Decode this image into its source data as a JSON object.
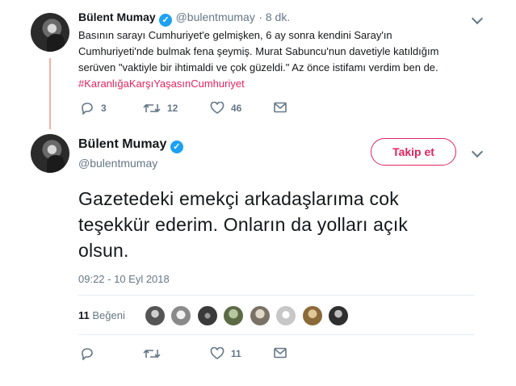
{
  "reply_tweet": {
    "name": "Bülent Mumay",
    "handle": "@bulentmumay",
    "time": "· 8 dk.",
    "text_lines": [
      "Basının sarayı Cumhuriyet'e gelmişken, 6 ay sonra kendini Saray'ın",
      "Cumhuriyeti'nde bulmak fena şeymiş. Murat Sabuncu'nun davetiyle katıldığım",
      "serüven \"vaktiyle bir ihtimaldi ve çok güzeldi.\" Az önce istifamı verdim ben de."
    ],
    "hashtag": "#KaranlığaKarşıYaşasınCumhuriyet",
    "replies": "3",
    "retweets": "12",
    "likes": "46"
  },
  "main_tweet": {
    "name": "Bülent Mumay",
    "handle": "@bulentmumay",
    "follow_label": "Takip et",
    "text": "Gazetedeki emekçi arkadaşlarıma cok teşekkür ederim. Onların da yolları açık olsun.",
    "timestamp": "09:22 - 10 Eyl 2018",
    "likes_count": "11",
    "likes_label": "Beğeni",
    "action_likes": "11"
  },
  "colors": {
    "accent": "#e0245e",
    "verified": "#1da1f2",
    "thread_line": "#f5b0a3",
    "muted": "#657786"
  },
  "icons": [
    "verified-icon",
    "chevron-down-icon",
    "reply-icon",
    "retweet-icon",
    "heart-icon",
    "message-icon"
  ]
}
